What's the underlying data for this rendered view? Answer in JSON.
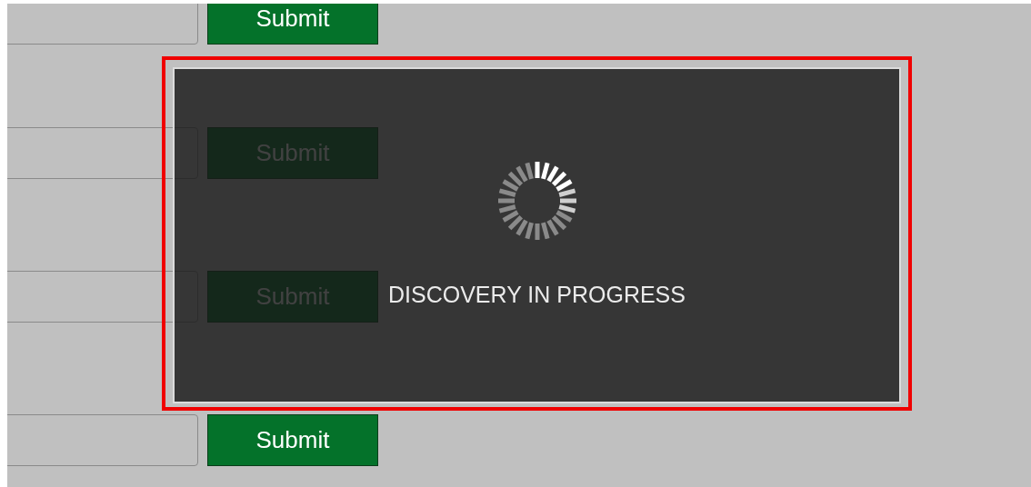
{
  "forms": [
    {
      "button": "Submit"
    },
    {
      "button": "Submit"
    },
    {
      "button": "Submit"
    },
    {
      "button": "Submit"
    }
  ],
  "overlay": {
    "message": "DISCOVERY IN PROGRESS",
    "highlighted": true
  }
}
